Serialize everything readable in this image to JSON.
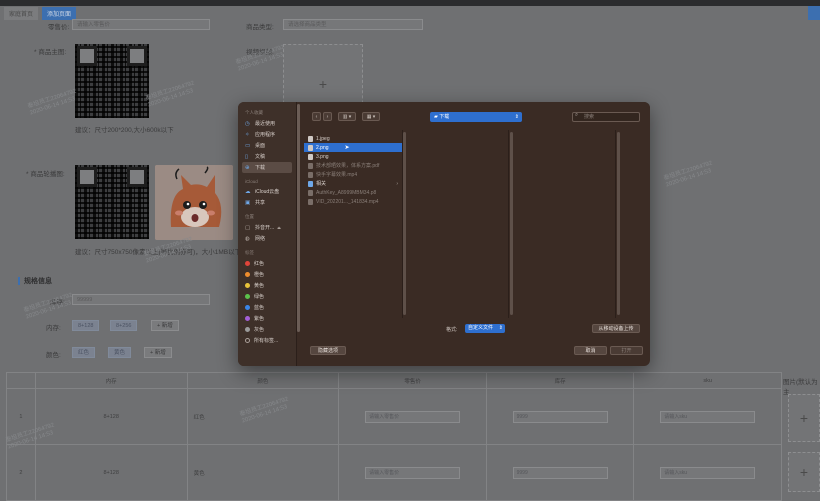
{
  "header": {
    "tabs": [
      "家庭首页",
      "添加页面"
    ]
  },
  "form": {
    "row1": {
      "label_left": "零售价:",
      "placeholder_left": "请输入零售价",
      "label_right": "商品类型:",
      "placeholder_right": "请选择商品类型"
    },
    "main_image_label": "* 商品主图:",
    "main_image_hint": "建议：尺寸200*200,大小600k以下",
    "video_label": "视频视频:",
    "detail_image_label": "* 商品轮播图:",
    "detail_image_hint": "建议：尺寸750x750像素以上(等比例亦可)，大小1MB以下",
    "spec_section_title": "规格信息",
    "stock_label": "库存:",
    "stock_value": "99999",
    "memory_label": "内存:",
    "memory_chips": [
      "8+128",
      "8+256"
    ],
    "memory_add": "+ 新增",
    "color_label": "颜色:",
    "color_chips": [
      "红色",
      "黄色"
    ],
    "color_add": "+ 新增",
    "table": {
      "headers": [
        "内存",
        "颜色",
        "零售价",
        "库存",
        "sku",
        "图片(默认为主"
      ],
      "rows": [
        {
          "index": "1",
          "memory": "8+128",
          "color": "红色",
          "price_placeholder": "请输入零售价",
          "stock": "9999",
          "sku_placeholder": "请输入sku"
        },
        {
          "index": "2",
          "memory": "8+128",
          "color": "黄色",
          "price_placeholder": "请输入零售价",
          "stock": "9999",
          "sku_placeholder": "请输入sku"
        }
      ]
    }
  },
  "watermark": {
    "line1": "泰坦员工22064792",
    "line2": "2020-06-14 14:53"
  },
  "dialog": {
    "sidebar": {
      "favorites_header": "个人收藏",
      "favorites": [
        {
          "label": "最近使用",
          "icon": "clock-icon"
        },
        {
          "label": "应用程序",
          "icon": "apps-icon"
        },
        {
          "label": "桌面",
          "icon": "desktop-icon"
        },
        {
          "label": "文稿",
          "icon": "document-icon"
        },
        {
          "label": "下载",
          "icon": "download-icon"
        }
      ],
      "icloud_header": "iCloud",
      "icloud": [
        {
          "label": "iCloud云盘",
          "icon": "cloud-icon"
        },
        {
          "label": "共享",
          "icon": "shared-folder-icon"
        }
      ],
      "locations_header": "位置",
      "locations": [
        {
          "label": "抖音开...",
          "icon": "disk-icon"
        },
        {
          "label": "网络",
          "icon": "globe-icon"
        }
      ],
      "tags_header": "标签",
      "tags": [
        {
          "label": "红色",
          "color": "#e0443a"
        },
        {
          "label": "橙色",
          "color": "#ef8d2d"
        },
        {
          "label": "黄色",
          "color": "#e9c33a"
        },
        {
          "label": "绿色",
          "color": "#5cc24b"
        },
        {
          "label": "蓝色",
          "color": "#3a86e8"
        },
        {
          "label": "紫色",
          "color": "#a35fd6"
        },
        {
          "label": "灰色",
          "color": "#9a9a9a"
        },
        {
          "label": "所有标签...",
          "color": ""
        }
      ]
    },
    "location": "下载",
    "search_placeholder": "搜索",
    "files": [
      {
        "name": "1.jpeg",
        "type": "image",
        "state": "normal"
      },
      {
        "name": "2.png",
        "type": "image",
        "state": "selected"
      },
      {
        "name": "3.png",
        "type": "image",
        "state": "normal"
      },
      {
        "name": "技术部晒效果，体系方案.pdf",
        "type": "doc",
        "state": "dim"
      },
      {
        "name": "快手字幕效果.mp4",
        "type": "doc",
        "state": "dim"
      },
      {
        "name": "相关",
        "type": "folder",
        "state": "normal"
      },
      {
        "name": "AuthKey_A8999MBM34.p8",
        "type": "doc",
        "state": "dim"
      },
      {
        "name": "VID_202201..._141834.mp4",
        "type": "doc",
        "state": "dim"
      }
    ],
    "format_label": "格式:",
    "format_value": "自定义文件",
    "upload_mobile_button": "从移动设备上传",
    "hide_options_button": "隐藏选项",
    "cancel_button": "取消",
    "open_button": "打开"
  }
}
